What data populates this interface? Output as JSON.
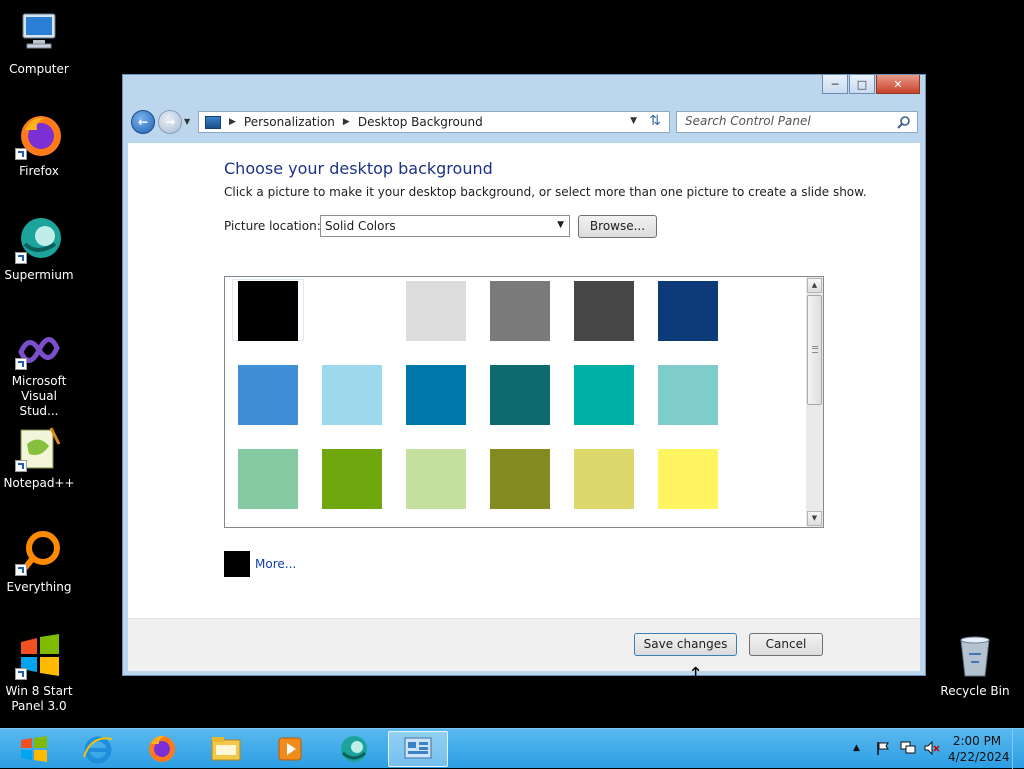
{
  "desktop": {
    "icons": [
      {
        "label": "Computer",
        "icon": "computer-icon"
      },
      {
        "label": "Firefox",
        "icon": "firefox-icon"
      },
      {
        "label": "Supermium",
        "icon": "supermium-icon"
      },
      {
        "label": "Microsoft Visual Stud...",
        "icon": "visual-studio-icon"
      },
      {
        "label": "Notepad++",
        "icon": "notepad-plus-plus-icon"
      },
      {
        "label": "Everything",
        "icon": "everything-icon"
      },
      {
        "label": "Win 8 Start Panel 3.0",
        "icon": "windows-logo-icon"
      },
      {
        "label": "Recycle Bin",
        "icon": "recycle-bin-icon"
      }
    ]
  },
  "window": {
    "breadcrumb": [
      "Personalization",
      "Desktop Background"
    ],
    "search_placeholder": "Search Control Panel",
    "title": "Choose your desktop background",
    "description": "Click a picture to make it your desktop background, or select more than one picture to create a slide show.",
    "picture_location_label": "Picture location:",
    "picture_location_value": "Solid Colors",
    "browse_label": "Browse...",
    "swatches": [
      [
        "#000000",
        "#ffffff",
        "#dcdcdc",
        "#7a7a7a",
        "#474747",
        "#0d3a78"
      ],
      [
        "#3f8fd6",
        "#9ed8ed",
        "#0077a9",
        "#0e6b6d",
        "#00b0a5",
        "#7fcdca"
      ],
      [
        "#84c9a1",
        "#6fa80e",
        "#c5df9f",
        "#838a1f",
        "#dcd86c",
        "#fff461"
      ]
    ],
    "selected_swatch_color": "#000000",
    "more_label": "More...",
    "save_label": "Save changes",
    "cancel_label": "Cancel"
  },
  "taskbar": {
    "apps": [
      "start-button",
      "internet-explorer-icon",
      "firefox-icon",
      "file-explorer-icon",
      "media-player-icon",
      "supermium-icon",
      "control-panel-icon"
    ],
    "clock_time": "2:00 PM",
    "clock_date": "4/22/2024"
  }
}
